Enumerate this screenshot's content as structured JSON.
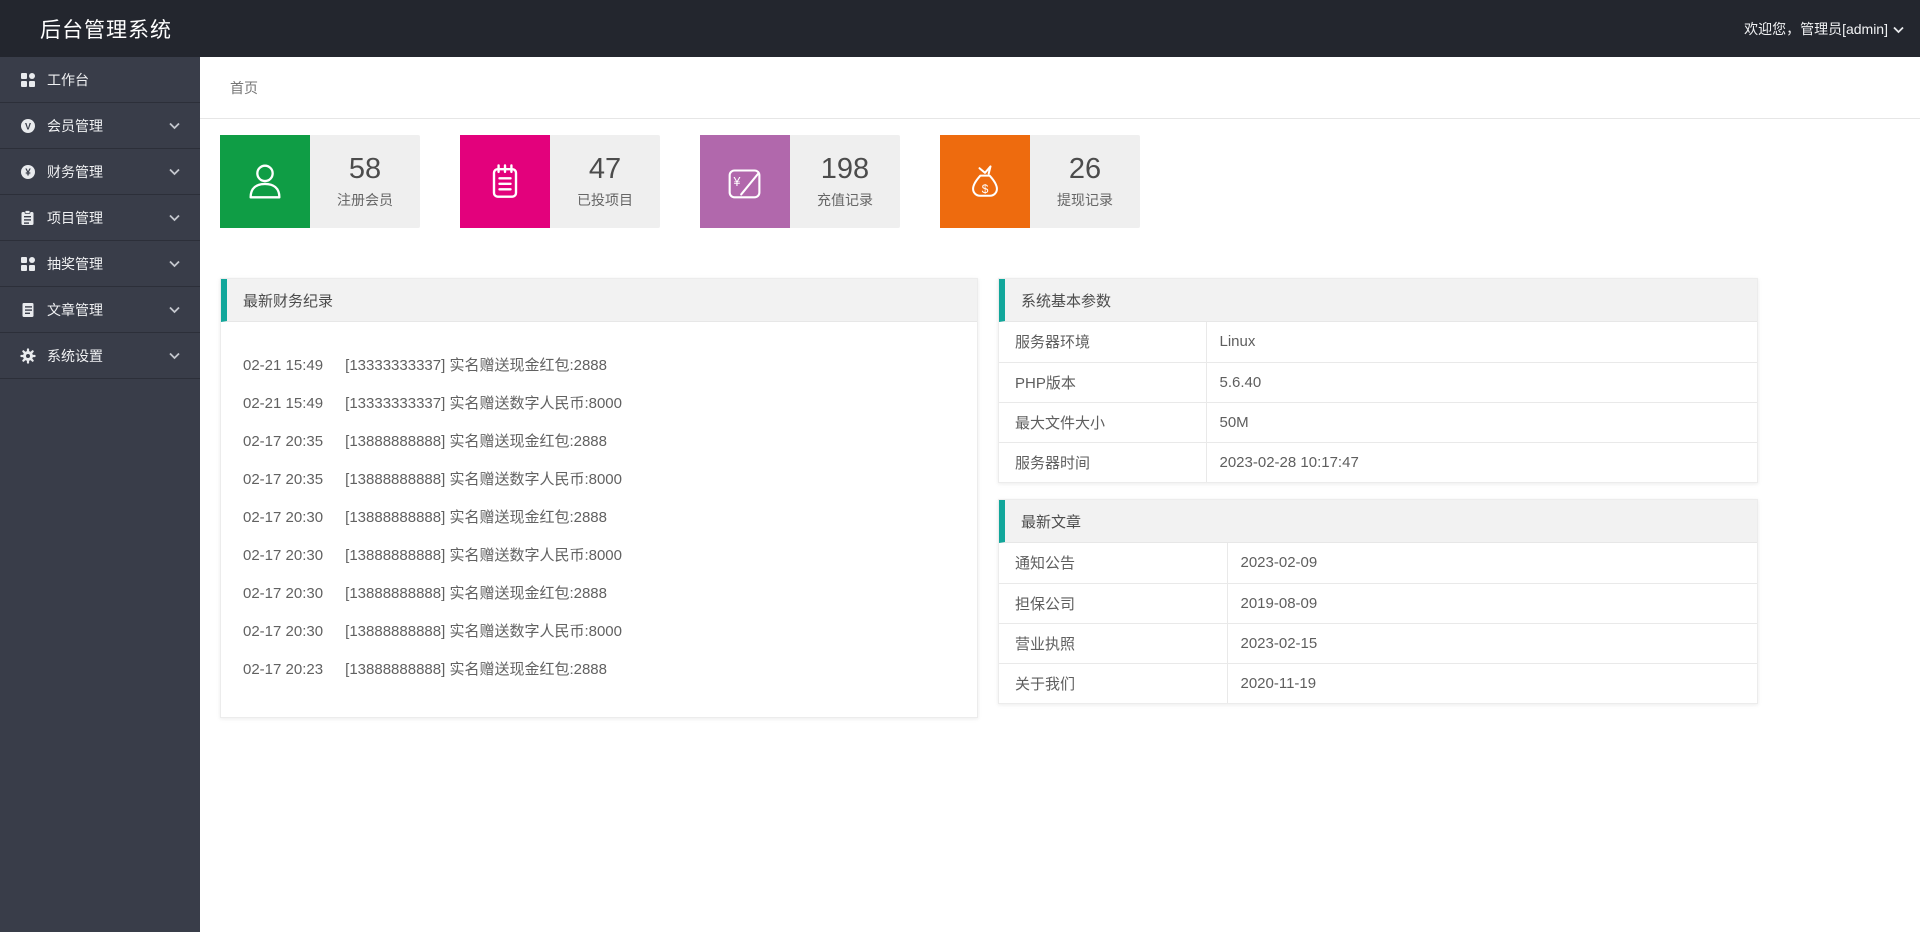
{
  "app": {
    "title": "后台管理系统",
    "welcome": "欢迎您，管理员[admin]"
  },
  "breadcrumb": {
    "home": "首页"
  },
  "sidebar": {
    "items": [
      {
        "label": "工作台",
        "icon": "console-grid-icon",
        "has_children": false
      },
      {
        "label": "会员管理",
        "icon": "member-circle-icon",
        "has_children": true
      },
      {
        "label": "财务管理",
        "icon": "finance-yen-icon",
        "has_children": true
      },
      {
        "label": "项目管理",
        "icon": "project-clipboard-icon",
        "has_children": true
      },
      {
        "label": "抽奖管理",
        "icon": "lottery-grid-icon",
        "has_children": true
      },
      {
        "label": "文章管理",
        "icon": "article-doc-icon",
        "has_children": true
      },
      {
        "label": "系统设置",
        "icon": "gear-icon",
        "has_children": true
      }
    ]
  },
  "stats": [
    {
      "value": "58",
      "label": "注册会员",
      "color": "#0f9d45",
      "icon": "user-icon"
    },
    {
      "value": "47",
      "label": "已投项目",
      "color": "#e3017c",
      "icon": "notepad-icon"
    },
    {
      "value": "198",
      "label": "充值记录",
      "color": "#b168ac",
      "icon": "yen-receipt-icon"
    },
    {
      "value": "26",
      "label": "提现记录",
      "color": "#ee6b0e",
      "icon": "money-bag-icon"
    }
  ],
  "finance_panel": {
    "title": "最新财务纪录",
    "records": [
      {
        "time": "02-21 15:49",
        "text": "[13333333337] 实名赠送现金红包:2888"
      },
      {
        "time": "02-21 15:49",
        "text": "[13333333337] 实名赠送数字人民币:8000"
      },
      {
        "time": "02-17 20:35",
        "text": "[13888888888] 实名赠送现金红包:2888"
      },
      {
        "time": "02-17 20:35",
        "text": "[13888888888] 实名赠送数字人民币:8000"
      },
      {
        "time": "02-17 20:30",
        "text": "[13888888888] 实名赠送现金红包:2888"
      },
      {
        "time": "02-17 20:30",
        "text": "[13888888888] 实名赠送数字人民币:8000"
      },
      {
        "time": "02-17 20:30",
        "text": "[13888888888] 实名赠送现金红包:2888"
      },
      {
        "time": "02-17 20:30",
        "text": "[13888888888] 实名赠送数字人民币:8000"
      },
      {
        "time": "02-17 20:23",
        "text": "[13888888888] 实名赠送现金红包:2888"
      }
    ]
  },
  "system_panel": {
    "title": "系统基本参数",
    "rows": [
      {
        "label": "服务器环境",
        "value": "Linux"
      },
      {
        "label": "PHP版本",
        "value": "5.6.40"
      },
      {
        "label": "最大文件大小",
        "value": "50M"
      },
      {
        "label": "服务器时间",
        "value": "2023-02-28 10:17:47"
      }
    ]
  },
  "articles_panel": {
    "title": "最新文章",
    "rows": [
      {
        "label": "通知公告",
        "value": "2023-02-09"
      },
      {
        "label": "担保公司",
        "value": "2019-08-09"
      },
      {
        "label": "营业执照",
        "value": "2023-02-15"
      },
      {
        "label": "关于我们",
        "value": "2020-11-19"
      }
    ]
  },
  "colors": {
    "header_bg": "#23262e",
    "sidebar_bg": "#393d49",
    "accent_teal": "#12a79b",
    "card_green": "#0f9d45",
    "card_pink": "#e3017c",
    "card_purple": "#b168ac",
    "card_orange": "#ee6b0e"
  }
}
